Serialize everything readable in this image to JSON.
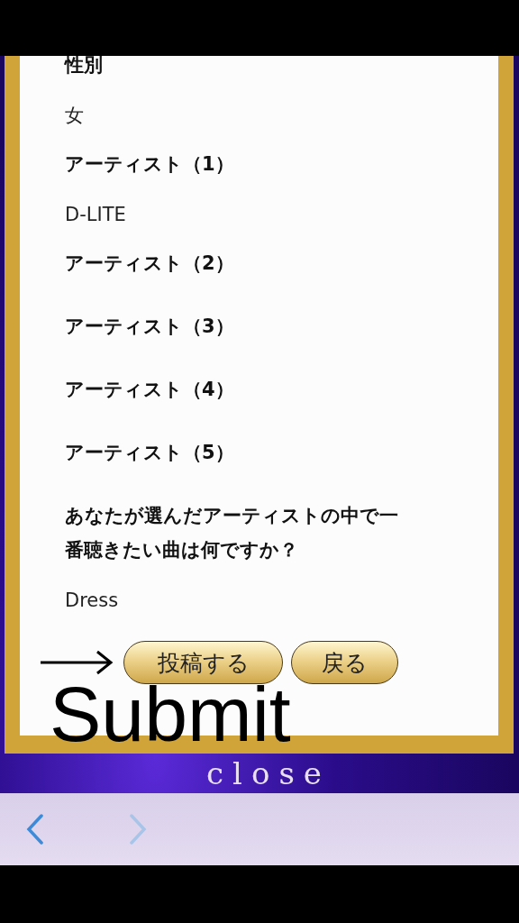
{
  "form": {
    "fields": [
      {
        "label": "性別",
        "value": "女"
      },
      {
        "label": "アーティスト（1）",
        "value": "D-LITE"
      },
      {
        "label": "アーティスト（2）"
      },
      {
        "label": "アーティスト（3）"
      },
      {
        "label": "アーティスト（4）"
      },
      {
        "label": "アーティスト（5）"
      },
      {
        "label": "あなたが選んだアーティストの中で一番聴きたい曲は何ですか？",
        "value": "Dress"
      }
    ],
    "buttons": [
      {
        "label": "投稿する",
        "kind": "submit"
      },
      {
        "label": "戻る",
        "kind": "back"
      }
    ]
  },
  "annotation": {
    "text": "Submit"
  },
  "background_text": "close",
  "toolbar": {
    "items": [
      {
        "kind": "back",
        "disabled": false
      },
      {
        "kind": "forward",
        "disabled": true
      }
    ]
  }
}
